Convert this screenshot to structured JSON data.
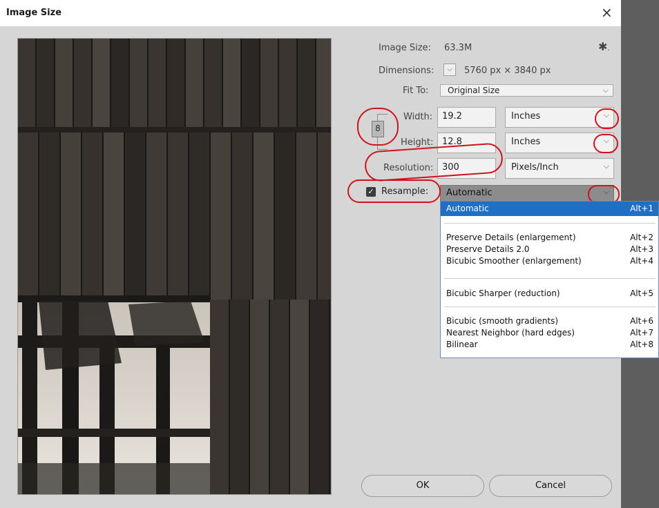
{
  "window": {
    "title": "Image Size",
    "close_glyph": "×"
  },
  "info": {
    "image_size_label": "Image Size:",
    "image_size_value": "63.3M",
    "dimensions_label": "Dimensions:",
    "dimensions_value": "5760 px  ×  3840 px",
    "gear_icon": "gear-icon"
  },
  "fit_to": {
    "label": "Fit To:",
    "value": "Original Size"
  },
  "width": {
    "label": "Width:",
    "value": "19.2",
    "unit": "Inches"
  },
  "height": {
    "label": "Height:",
    "value": "12.8",
    "unit": "Inches"
  },
  "resolution": {
    "label": "Resolution:",
    "value": "300",
    "unit": "Pixels/Inch"
  },
  "resample": {
    "label": "Resample:",
    "checked": true,
    "value": "Automatic",
    "options": [
      {
        "label": "Automatic",
        "shortcut": "Alt+1",
        "selected": true
      },
      {
        "label": "Preserve Details (enlargement)",
        "shortcut": "Alt+2"
      },
      {
        "label": "Preserve Details 2.0",
        "shortcut": "Alt+3"
      },
      {
        "label": "Bicubic Smoother (enlargement)",
        "shortcut": "Alt+4"
      },
      {
        "label": "Bicubic Sharper (reduction)",
        "shortcut": "Alt+5"
      },
      {
        "label": "Bicubic (smooth gradients)",
        "shortcut": "Alt+6"
      },
      {
        "label": "Nearest Neighbor (hard edges)",
        "shortcut": "Alt+7"
      },
      {
        "label": "Bilinear",
        "shortcut": "Alt+8"
      }
    ]
  },
  "buttons": {
    "ok": "OK",
    "cancel": "Cancel"
  },
  "colors": {
    "accent": "#1f6fc5",
    "annotation": "#d0121b",
    "dialog_bg": "#d6d6d6"
  }
}
